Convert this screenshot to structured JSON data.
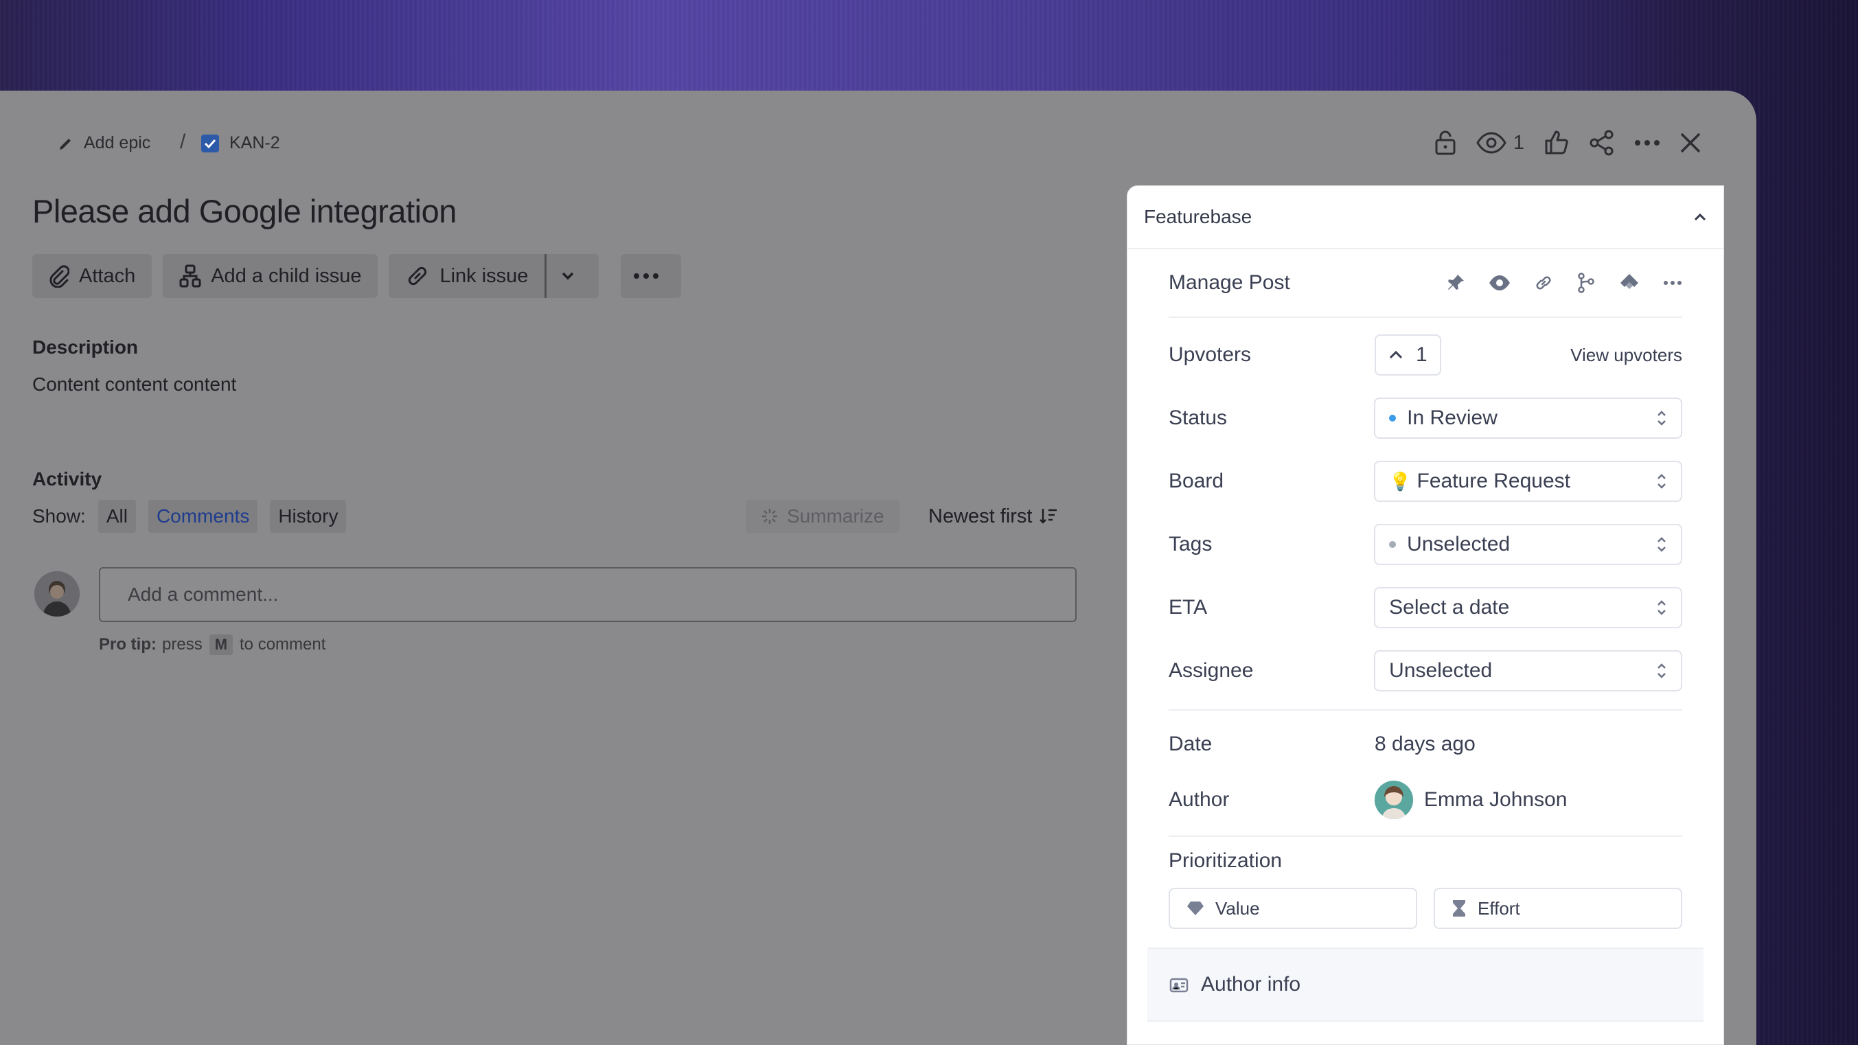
{
  "breadcrumb": {
    "epic_label": "Add epic",
    "separator": "/",
    "issue_key": "KAN-2"
  },
  "header": {
    "watch_count": "1"
  },
  "issue": {
    "title": "Please add Google integration"
  },
  "actions": {
    "attach": "Attach",
    "child": "Add a child issue",
    "link": "Link issue"
  },
  "description": {
    "heading": "Description",
    "text": "Content content content"
  },
  "activity": {
    "heading": "Activity",
    "show_label": "Show:",
    "filters": [
      "All",
      "Comments",
      "History"
    ],
    "summarize": "Summarize",
    "sort": "Newest first",
    "comment_placeholder": "Add a comment...",
    "protip_bold": "Pro tip:",
    "protip_pre": "press",
    "protip_key": "M",
    "protip_post": "to comment"
  },
  "featurebase": {
    "title": "Featurebase",
    "manage_post": "Manage Post",
    "upvoters_label": "Upvoters",
    "upvote_count": "1",
    "view_upvoters": "View upvoters",
    "status_label": "Status",
    "status_value": "In Review",
    "status_color": "#3b9be8",
    "board_label": "Board",
    "board_value": "Feature Request",
    "board_icon": "💡",
    "tags_label": "Tags",
    "tags_value": "Unselected",
    "eta_label": "ETA",
    "eta_value": "Select a date",
    "assignee_label": "Assignee",
    "assignee_value": "Unselected",
    "date_label": "Date",
    "date_value": "8 days ago",
    "author_label": "Author",
    "author_name": "Emma Johnson",
    "prioritization_label": "Prioritization",
    "value_btn": "Value",
    "effort_btn": "Effort",
    "author_info": "Author info"
  }
}
